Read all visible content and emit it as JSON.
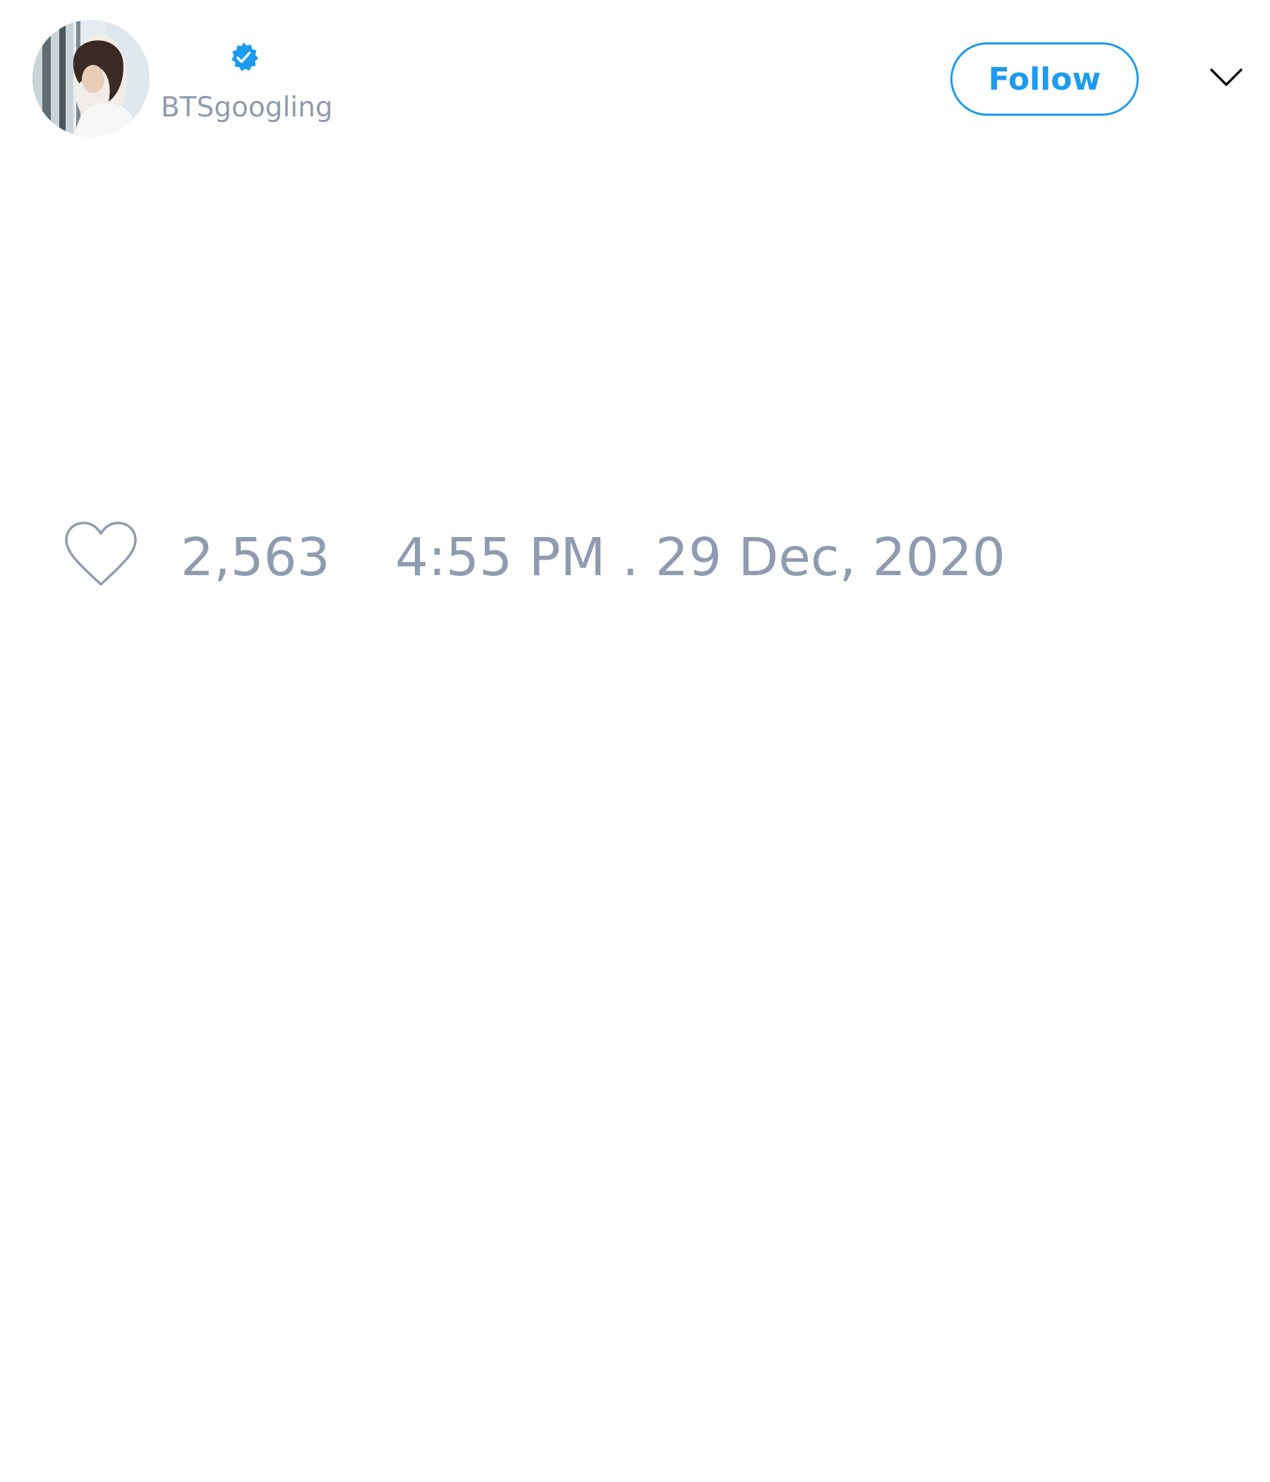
{
  "tweet": {
    "author": {
      "handle": "BTSgoogling",
      "verified": true,
      "avatar_icon": "profile-photo"
    },
    "follow_label": "Follow",
    "menu_icon": "chevron-down-icon",
    "like_icon": "heart-outline-icon",
    "like_count": "2,563",
    "timestamp": "4:55 PM . 29 Dec, 2020"
  },
  "colors": {
    "accent": "#1d9bf0",
    "muted_text": "#8f9bb0",
    "background": "#ffffff"
  }
}
